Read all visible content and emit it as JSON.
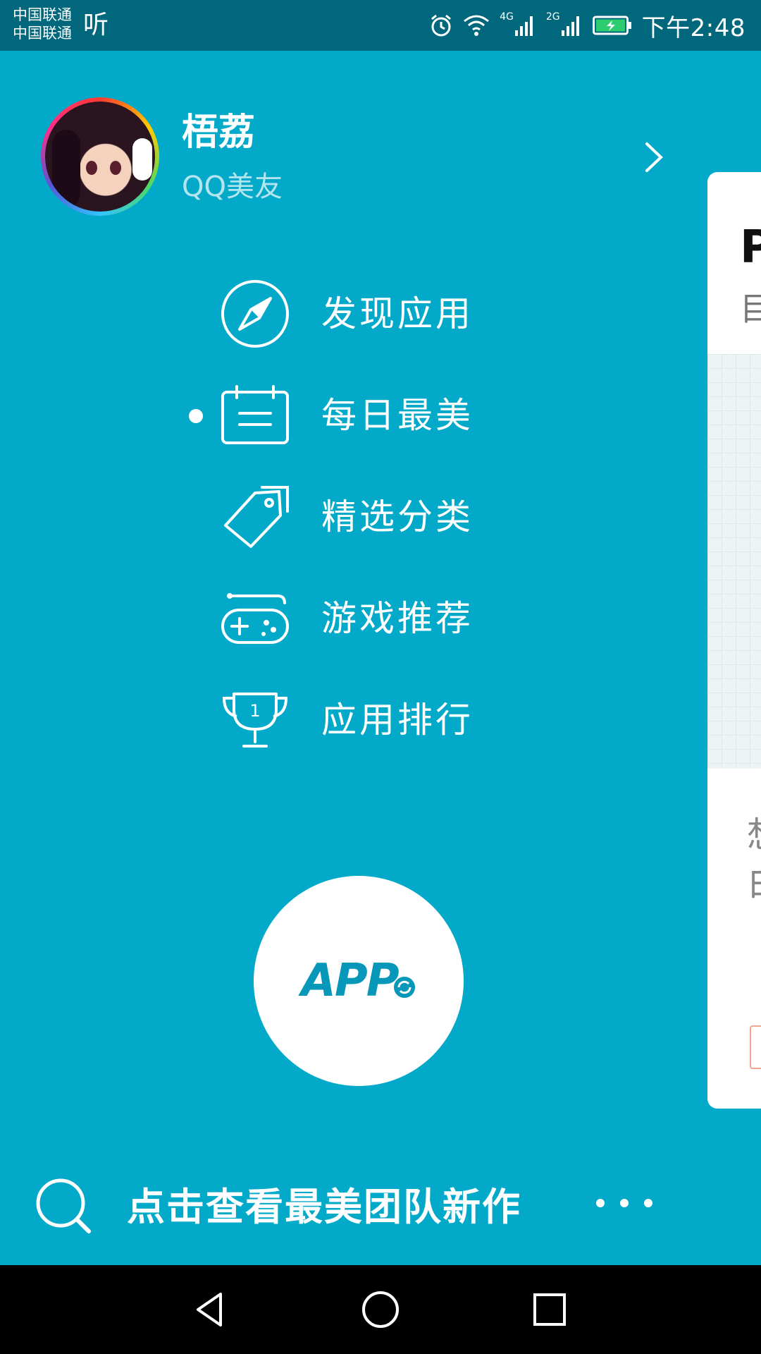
{
  "status_bar": {
    "carrier_1": "中国联通",
    "carrier_2": "中国联通",
    "ting": "听",
    "net_1": "4G",
    "net_2": "2G",
    "time": "下午2:48",
    "icons": [
      "alarm-icon",
      "wifi-icon",
      "signal-icon",
      "signal-icon",
      "battery-charging-icon"
    ]
  },
  "profile": {
    "name": "梧荔",
    "subtitle": "QQ美友"
  },
  "menu": {
    "items": [
      {
        "label": "发现应用",
        "icon": "compass-icon"
      },
      {
        "label": "每日最美",
        "icon": "calendar-icon",
        "active": true
      },
      {
        "label": "精选分类",
        "icon": "tag-icon"
      },
      {
        "label": "游戏推荐",
        "icon": "gamepad-icon"
      },
      {
        "label": "应用排行",
        "icon": "trophy-icon"
      }
    ]
  },
  "center_logo": "APP",
  "search": {
    "label": "点击查看最美团队新作"
  },
  "card": {
    "title_fragment": "P",
    "sub_fragment": "目",
    "text_fragment_1": "想",
    "text_fragment_2": "白"
  },
  "colors": {
    "background": "#03a9c8",
    "status_bar": "#01677c",
    "logo": "#0797b8"
  }
}
